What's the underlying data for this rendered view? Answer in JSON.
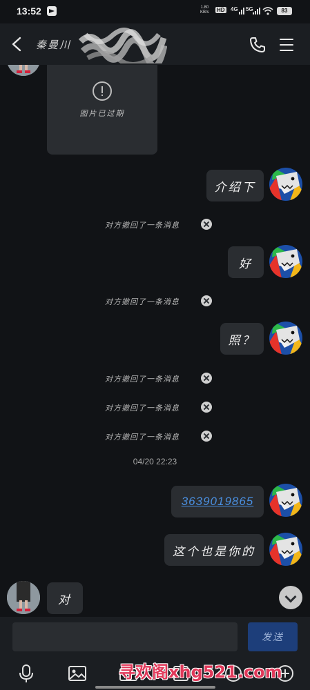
{
  "status_bar": {
    "time": "13:52",
    "net_speed_value": "1.80",
    "net_speed_unit": "KB/s",
    "hd_badge": "HD",
    "network_1": "4G",
    "network_2": "5G",
    "battery": "83"
  },
  "header": {
    "contact_name": "秦曼川"
  },
  "chat": {
    "expired_image_label": "图片已过期",
    "messages": [
      {
        "side": "right",
        "text": "介绍下"
      },
      {
        "side": "system",
        "text": "对方撤回了一条消息"
      },
      {
        "side": "right",
        "text": "好"
      },
      {
        "side": "system",
        "text": "对方撤回了一条消息"
      },
      {
        "side": "right",
        "text": "照？"
      },
      {
        "side": "system",
        "text": "对方撤回了一条消息"
      },
      {
        "side": "system",
        "text": "对方撤回了一条消息"
      },
      {
        "side": "system",
        "text": "对方撤回了一条消息"
      },
      {
        "side": "timestamp",
        "text": "04/20 22:23"
      },
      {
        "side": "right",
        "text": "3639019865",
        "link": true
      },
      {
        "side": "right",
        "text": "这个也是你的"
      },
      {
        "side": "left",
        "text": "对"
      }
    ]
  },
  "input": {
    "value": "",
    "send_label": "发送"
  },
  "toolbar": {
    "icons": [
      "microphone-icon",
      "image-icon",
      "camera-icon",
      "file-icon",
      "emoji-icon",
      "plus-icon"
    ]
  },
  "watermark": "寻欢阁xhg521.com",
  "colors": {
    "background": "#111316",
    "bubble": "#2a2d31",
    "link": "#4a8fe0",
    "send_button": "#1d3e7a"
  }
}
